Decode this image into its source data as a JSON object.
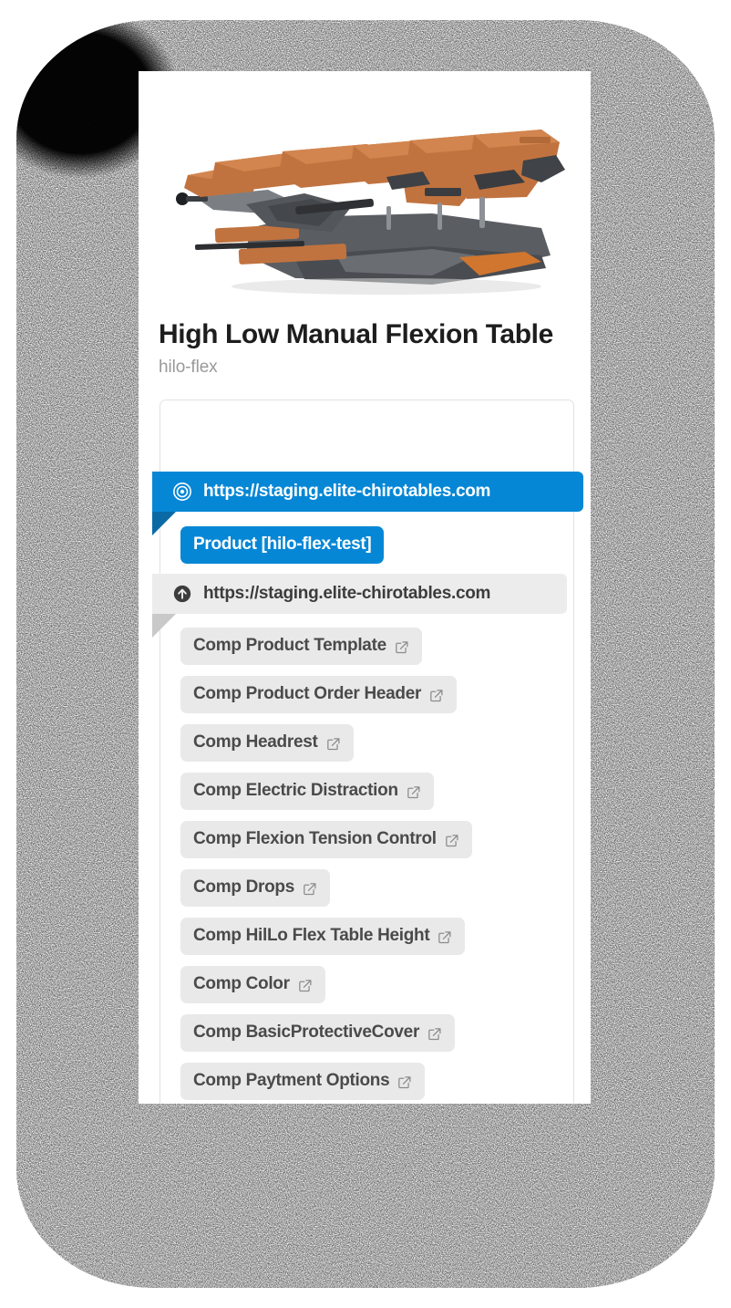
{
  "colors": {
    "accent_blue": "#0587d6",
    "accent_blue_dark": "#0b6aa6",
    "pill_gray": "#e9e9e9",
    "bar_gray": "#ececec",
    "text_dark": "#1d1d1d",
    "text_muted": "#999999",
    "card_white": "#ffffff",
    "backdrop_black": "#050505",
    "product_upholstery": "#c1733f",
    "product_base": "#4d5055"
  },
  "product": {
    "title": "High Low Manual Flexion Table",
    "sku": "hilo-flex",
    "image_alt": "chiropractic-high-low-flexion-table"
  },
  "panel": {
    "selected_row": {
      "icon": "target-icon",
      "url": "https://staging.elite-chirotables.com",
      "selected": true
    },
    "selected_pill": {
      "label": "Product [hilo-flex-test]",
      "icon": null
    },
    "parent_row": {
      "icon": "arrow-up-circle-icon",
      "url": "https://staging.elite-chirotables.com",
      "selected": false
    },
    "components": [
      {
        "label": "Comp Product Template",
        "icon": "external-link-icon"
      },
      {
        "label": "Comp Product Order Header",
        "icon": "external-link-icon"
      },
      {
        "label": "Comp Headrest",
        "icon": "external-link-icon"
      },
      {
        "label": "Comp Electric Distraction",
        "icon": "external-link-icon"
      },
      {
        "label": "Comp Flexion Tension Control",
        "icon": "external-link-icon"
      },
      {
        "label": "Comp Drops",
        "icon": "external-link-icon"
      },
      {
        "label": "Comp HilLo Flex Table Height",
        "icon": "external-link-icon"
      },
      {
        "label": "Comp Color",
        "icon": "external-link-icon"
      },
      {
        "label": "Comp BasicProtectiveCover",
        "icon": "external-link-icon"
      },
      {
        "label": "Comp Paytment Options",
        "icon": "external-link-icon"
      }
    ]
  }
}
